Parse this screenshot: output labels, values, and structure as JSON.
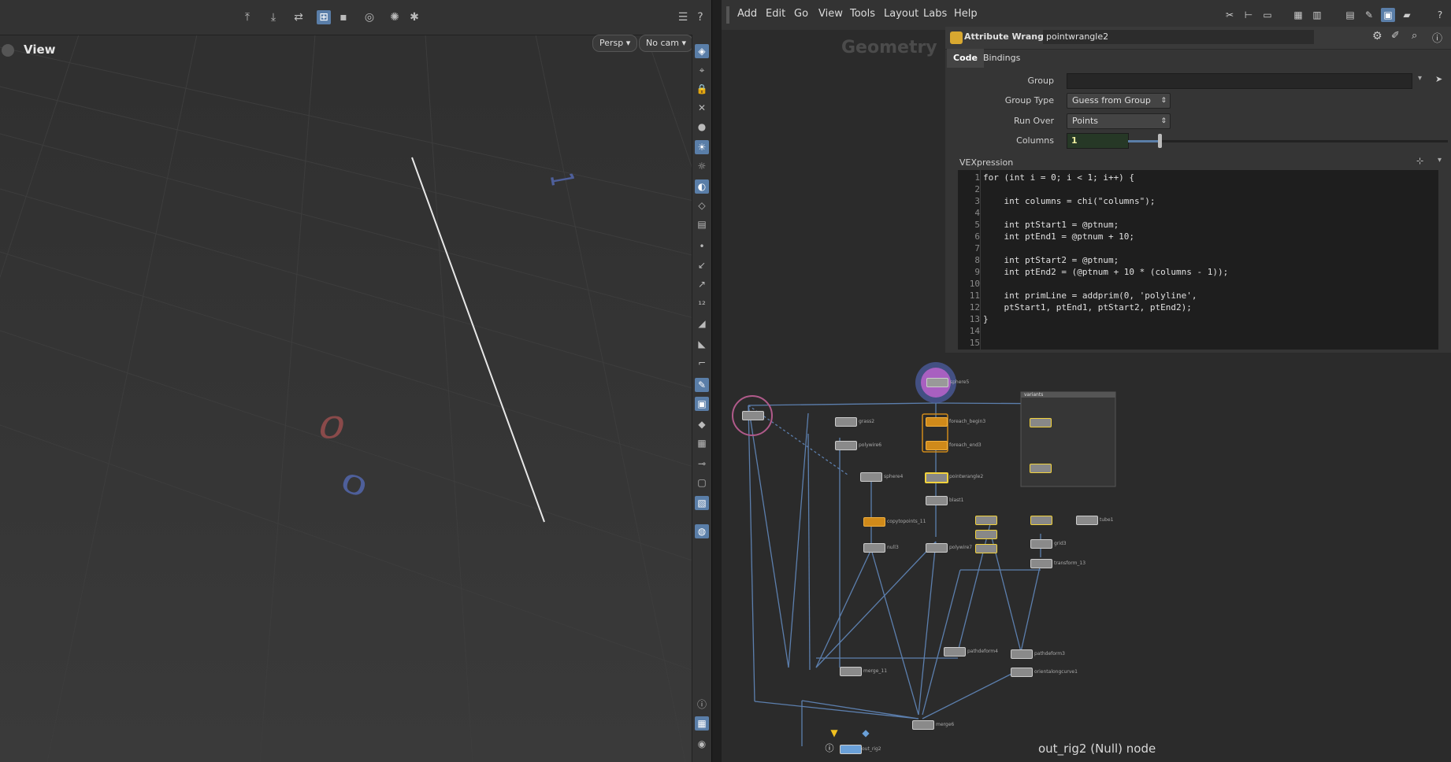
{
  "viewport": {
    "title": "View",
    "persp_label": "Persp",
    "cam_label": "No cam",
    "axis_labels": [
      "0",
      "0",
      "1"
    ]
  },
  "menubar": {
    "items": [
      "Add",
      "Edit",
      "Go",
      "View",
      "Tools",
      "Layout",
      "Labs",
      "Help"
    ]
  },
  "network": {
    "context_label": "Geometry",
    "status_text": "out_rig2 (Null) node",
    "nodes": [
      {
        "label": "sphere5"
      },
      {
        "label": "grass2"
      },
      {
        "label": "polywire6"
      },
      {
        "label": "foreach_begin3"
      },
      {
        "label": "foreach_end3"
      },
      {
        "label": "sphere4"
      },
      {
        "label": "pointwrangle2"
      },
      {
        "label": "blast1"
      },
      {
        "label": "copytopoints_11"
      },
      {
        "label": "null3"
      },
      {
        "label": "polywire7"
      },
      {
        "label": "grid3"
      },
      {
        "label": "transform_13"
      },
      {
        "label": "tube1"
      },
      {
        "label": "pathdeform4"
      },
      {
        "label": "pathdeform3"
      },
      {
        "label": "orientalongcurve1"
      },
      {
        "label": "merge_11"
      },
      {
        "label": "merge6"
      },
      {
        "label": "out_rig2"
      },
      {
        "label": "variants"
      }
    ]
  },
  "parm": {
    "node_type": "Attribute Wrangle",
    "node_name": "pointwrangle2",
    "tabs": [
      "Code",
      "Bindings"
    ],
    "group_label": "Group",
    "group_value": "",
    "group_type_label": "Group Type",
    "group_type_value": "Guess from Group",
    "run_over_label": "Run Over",
    "run_over_value": "Points",
    "columns_label": "Columns",
    "columns_value": "1",
    "columns_slider_fraction": 0.11,
    "vex_label": "VEXpression",
    "code_lines": [
      "for (int i = 0; i < 1; i++) {",
      "",
      "    int columns = chi(\"columns\");",
      "",
      "    int ptStart1 = @ptnum;",
      "    int ptEnd1 = @ptnum + 10;",
      "",
      "    int ptStart2 = @ptnum;",
      "    int ptEnd2 = (@ptnum + 10 * (columns - 1));",
      "",
      "    int primLine = addprim(0, 'polyline',",
      "    ptStart1, ptEnd1, ptStart2, ptEnd2);",
      "}",
      "",
      ""
    ]
  },
  "colors": {
    "accent": "#5a7ea8",
    "node_orange": "#d08a1a",
    "node_selected": "#f2d23c",
    "highlight_purple": "#a860c0"
  }
}
